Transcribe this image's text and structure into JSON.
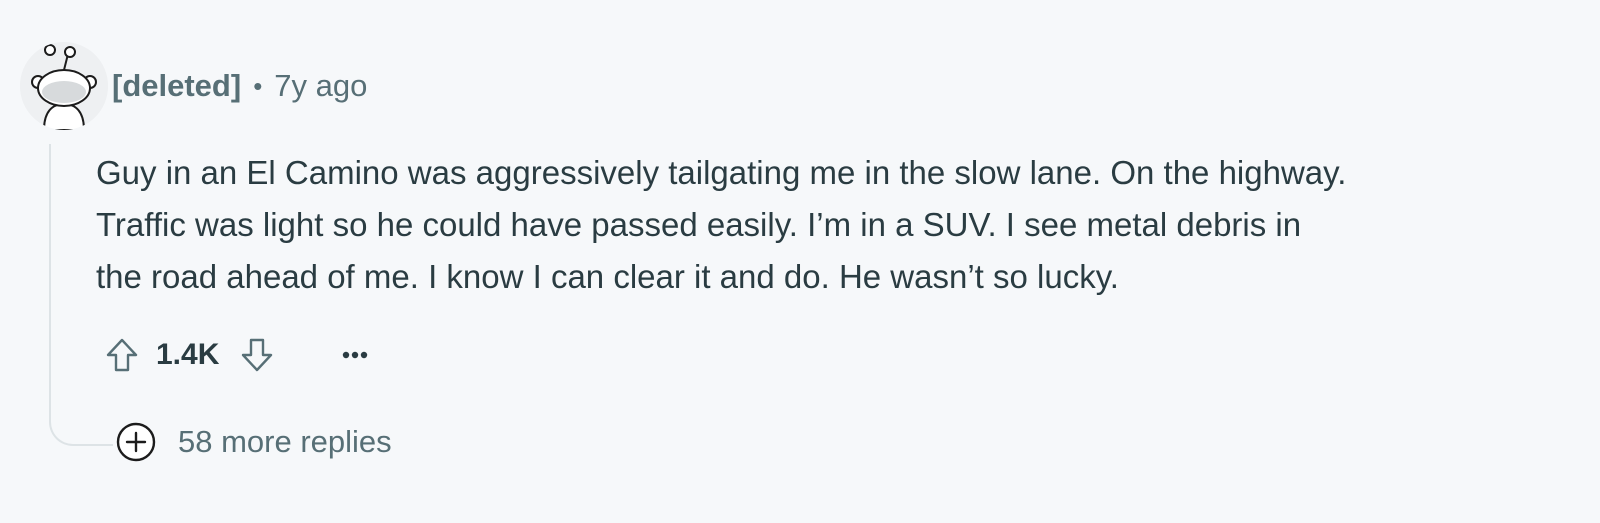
{
  "comment": {
    "author": "[deleted]",
    "separator": "•",
    "timestamp": "7y ago",
    "body_lines": [
      "Guy in an El Camino was aggressively tailgating me in the slow lane. On the highway.",
      "Traffic was light so he could have passed easily. I’m in a SUV. I see metal debris in",
      "the road ahead of me. I know I can clear it and do. He wasn’t so lucky."
    ],
    "score": "1.4K",
    "more_replies": "58 more replies"
  },
  "icons": {
    "avatar": "snoo-avatar-icon",
    "upvote": "arrow-up-icon",
    "downvote": "arrow-down-icon",
    "more": "ellipsis-icon",
    "expand": "plus-circle-icon"
  },
  "colors": {
    "background": "#f6f8fa",
    "meta_text": "#576f76",
    "body_text": "#2a3c42",
    "thread_line": "#dde3e6"
  }
}
